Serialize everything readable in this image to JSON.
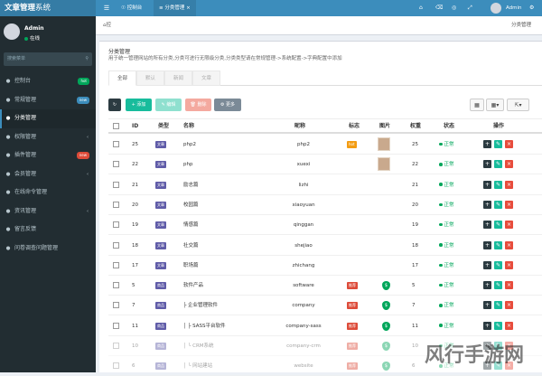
{
  "app": {
    "title_bold": "文章管理",
    "title_light": "系统"
  },
  "user": {
    "name": "Admin",
    "status": "在线"
  },
  "search": {
    "placeholder": "搜索菜单"
  },
  "menu": [
    {
      "label": "控制台",
      "icon": "dashboard-icon",
      "badge": "hot",
      "badge_color": "#00a65a"
    },
    {
      "label": "常规管理",
      "icon": "cogs-icon",
      "badge": "new",
      "badge_color": "#3c8dbc"
    },
    {
      "label": "分类管理",
      "icon": "list-icon",
      "active": true
    },
    {
      "label": "权限管理",
      "icon": "group-icon",
      "chevron": true
    },
    {
      "label": "插件管理",
      "icon": "rocket-icon",
      "badge": "new",
      "badge_color": "#dd4b39"
    },
    {
      "label": "会员管理",
      "icon": "user-icon",
      "chevron": true
    },
    {
      "label": "在线命令管理",
      "icon": "terminal-icon"
    },
    {
      "label": "资讯管理",
      "icon": "circle-icon",
      "chevron": true
    },
    {
      "label": "留言反馈",
      "icon": "circle-icon"
    },
    {
      "label": "问卷调查问题管理",
      "icon": "circle-icon"
    }
  ],
  "topbar": {
    "tab_dashboard": "控制台",
    "tab_category": "分类管理",
    "user": "Admin"
  },
  "breadcrumb": {
    "left": "控制台",
    "right": "分类管理"
  },
  "panel": {
    "title": "分类管理",
    "desc": "用于统一管理网站的所有分类,分类可进行无限级分类,分类类型请在常规管理->系统配置->字典配置中添加",
    "tabs": [
      "全部",
      "默认",
      "新闻",
      "文章"
    ],
    "toolbar": {
      "add": "添加",
      "edit": "编辑",
      "delete": "删除",
      "more": "更多"
    }
  },
  "columns": [
    "ID",
    "类型",
    "名称",
    "昵称",
    "标志",
    "图片",
    "权重",
    "状态",
    "操作"
  ],
  "rows": [
    {
      "id": "25",
      "type": "文章",
      "name": "php2",
      "nick": "php2",
      "flag": "hot",
      "pic": true,
      "weight": "25",
      "status": "正常"
    },
    {
      "id": "22",
      "type": "文章",
      "name": "php",
      "nick": "xuexi",
      "flag": "",
      "pic": true,
      "weight": "22",
      "status": "正常"
    },
    {
      "id": "21",
      "type": "文章",
      "name": "励志篇",
      "nick": "lizhi",
      "flag": "",
      "pic": false,
      "weight": "21",
      "status": "正常"
    },
    {
      "id": "20",
      "type": "文章",
      "name": "校园篇",
      "nick": "xiaoyuan",
      "flag": "",
      "pic": false,
      "weight": "20",
      "status": "正常"
    },
    {
      "id": "19",
      "type": "文章",
      "name": "情感篇",
      "nick": "qinggan",
      "flag": "",
      "pic": false,
      "weight": "19",
      "status": "正常"
    },
    {
      "id": "18",
      "type": "文章",
      "name": "社交篇",
      "nick": "shejiao",
      "flag": "",
      "pic": false,
      "weight": "18",
      "status": "正常"
    },
    {
      "id": "17",
      "type": "文章",
      "name": "职场篇",
      "nick": "zhichang",
      "flag": "",
      "pic": false,
      "weight": "17",
      "status": "正常"
    },
    {
      "id": "5",
      "type": "商品",
      "name": "软件产品",
      "nick": "software",
      "flag": "推荐",
      "pic": "shield",
      "weight": "5",
      "status": "正常"
    },
    {
      "id": "7",
      "type": "商品",
      "name": "├ 企业管理软件",
      "nick": "company",
      "flag": "推荐",
      "pic": "shield",
      "weight": "7",
      "status": "正常"
    },
    {
      "id": "11",
      "type": "商品",
      "name": "│ ├ SASS平台软件",
      "nick": "company-sass",
      "flag": "推荐",
      "pic": "shield",
      "weight": "11",
      "status": "正常"
    },
    {
      "id": "10",
      "type": "商品",
      "name": "│ └ CRM系统",
      "nick": "company-crm",
      "flag": "推荐",
      "pic": "shield",
      "weight": "10",
      "status": "正常",
      "faded": true
    },
    {
      "id": "6",
      "type": "商品",
      "name": "│ └ 网站建站",
      "nick": "website",
      "flag": "推荐",
      "pic": "shield",
      "weight": "6",
      "status": "正常",
      "faded": true
    }
  ],
  "watermark": "风行手游网"
}
